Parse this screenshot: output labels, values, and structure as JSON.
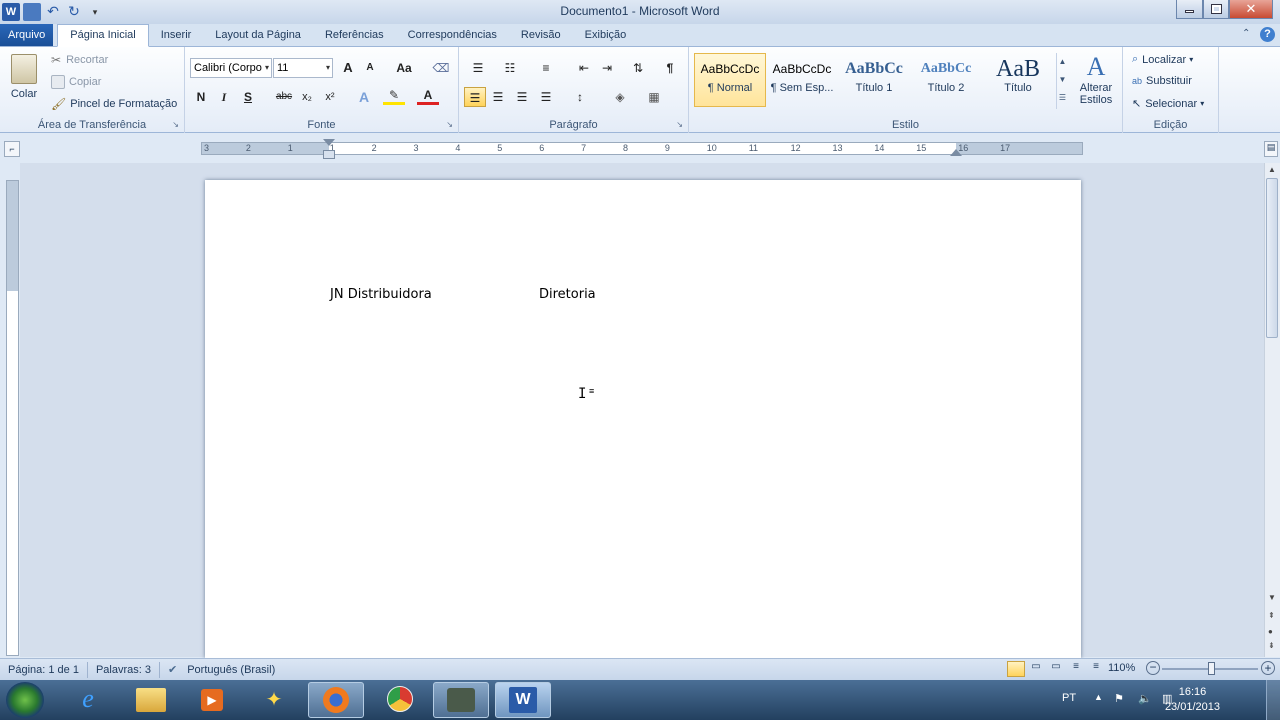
{
  "titlebar": {
    "title": "Documento1  -  Microsoft Word"
  },
  "tabs": {
    "file": "Arquivo",
    "items": [
      "Página Inicial",
      "Inserir",
      "Layout da Página",
      "Referências",
      "Correspondências",
      "Revisão",
      "Exibição"
    ]
  },
  "clipboard": {
    "paste": "Colar",
    "cut": "Recortar",
    "copy": "Copiar",
    "format_painter": "Pincel de Formatação",
    "label": "Área de Transferência"
  },
  "font": {
    "name": "Calibri (Corpo",
    "size": "11",
    "label": "Fonte",
    "bold": "N",
    "italic": "I",
    "underline": "S",
    "strike": "abc",
    "sub": "x₂",
    "sup": "x²",
    "grow": "A",
    "shrink": "A",
    "case": "Aa",
    "color_letter": "A"
  },
  "paragraph": {
    "label": "Parágrafo",
    "pilcrow": "¶"
  },
  "styles": {
    "label": "Estilo",
    "items": [
      {
        "preview": "AaBbCcDc",
        "name": "¶ Normal"
      },
      {
        "preview": "AaBbCcDc",
        "name": "¶ Sem Esp..."
      },
      {
        "preview": "AaBbCc",
        "name": "Título 1"
      },
      {
        "preview": "AaBbCc",
        "name": "Título 2"
      },
      {
        "preview": "AaB",
        "name": "Título"
      }
    ],
    "change_line1": "Alterar",
    "change_line2": "Estilos"
  },
  "editing": {
    "label": "Edição",
    "find": "Localizar",
    "replace": "Substituir",
    "select": "Selecionar"
  },
  "ruler": {
    "marks": [
      "3",
      "2",
      "1",
      "1",
      "2",
      "3",
      "4",
      "5",
      "6",
      "7",
      "8",
      "9",
      "10",
      "11",
      "12",
      "13",
      "14",
      "15",
      "16",
      "17"
    ]
  },
  "document": {
    "text1": "JN Distribuidora",
    "text2": "Diretoria"
  },
  "statusbar": {
    "page": "Página: 1 de 1",
    "words": "Palavras: 3",
    "language": "Português (Brasil)",
    "zoom": "110%"
  },
  "taskbar": {
    "lang": "PT",
    "time": "16:16",
    "date": "23/01/2013"
  },
  "colors": {
    "accent": "#2a67b9",
    "ribbon": "#e4ecf7"
  }
}
